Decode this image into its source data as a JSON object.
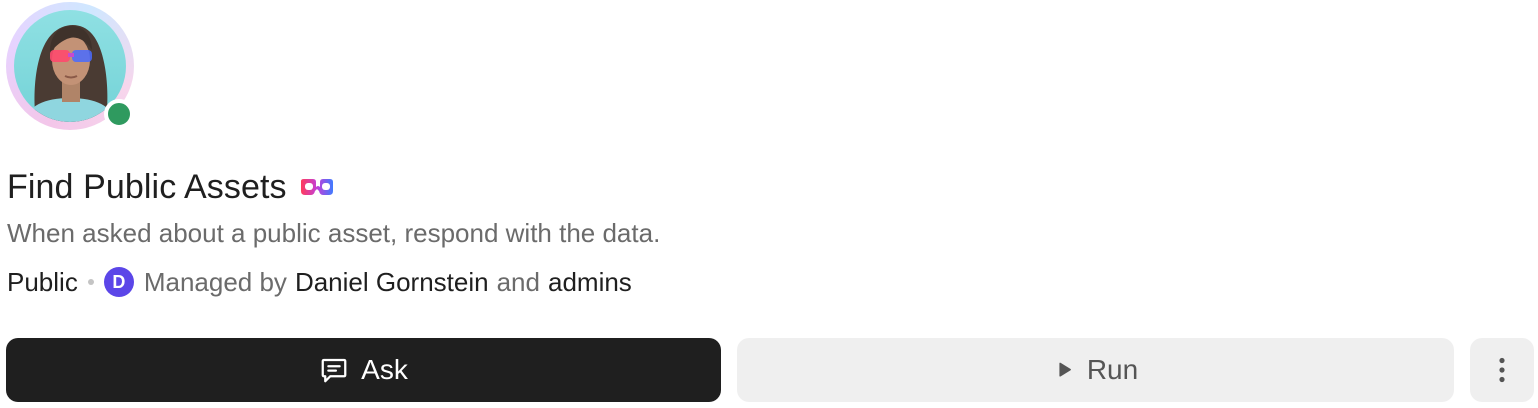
{
  "agent": {
    "title": "Find Public Assets",
    "description": "When asked about a public asset, respond with the data.",
    "visibility": "Public",
    "managed_by_prefix": "Managed by",
    "owner_initial": "D",
    "owner_name": "Daniel Gornstein",
    "conjunction": "and",
    "co_manager": "admins",
    "online_status_color": "#2f9a5f",
    "owner_avatar_color": "#5b46e8"
  },
  "actions": {
    "ask_label": "Ask",
    "run_label": "Run",
    "more_icon": "more-vertical-icon"
  },
  "icons": {
    "ask": "message-square-icon",
    "run": "play-icon",
    "badge": "mask-glasses-icon"
  }
}
